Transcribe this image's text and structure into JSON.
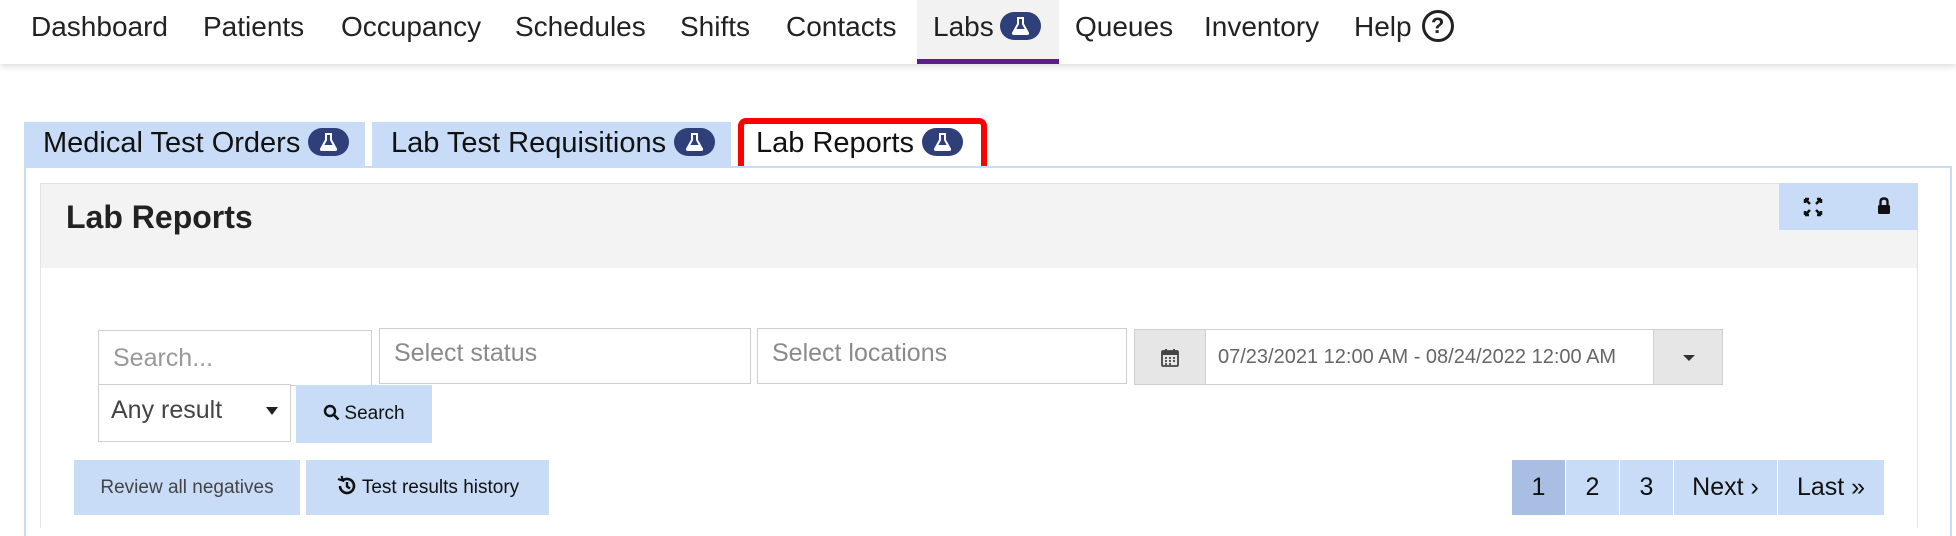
{
  "nav": {
    "items": [
      {
        "label": "Dashboard"
      },
      {
        "label": "Patients"
      },
      {
        "label": "Occupancy"
      },
      {
        "label": "Schedules"
      },
      {
        "label": "Shifts"
      },
      {
        "label": "Contacts"
      },
      {
        "label": "Labs"
      },
      {
        "label": "Queues"
      },
      {
        "label": "Inventory"
      },
      {
        "label": "Help"
      }
    ],
    "active": "Labs",
    "help_icon": "?"
  },
  "subtabs": [
    {
      "label": "Medical Test Orders"
    },
    {
      "label": "Lab Test Requisitions"
    },
    {
      "label": "Lab Reports"
    }
  ],
  "panel": {
    "title": "Lab Reports"
  },
  "filters": {
    "search_placeholder": "Search...",
    "status_placeholder": "Select status",
    "locations_placeholder": "Select locations",
    "date_range": "07/23/2021 12:00 AM - 08/24/2022 12:00 AM",
    "result_select": "Any result",
    "search_button": "Search"
  },
  "actions": {
    "review_negatives": "Review all negatives",
    "test_history": "Test results history"
  },
  "pagination": {
    "pages": [
      "1",
      "2",
      "3"
    ],
    "current": "1",
    "next": "Next ›",
    "last": "Last »"
  },
  "colors": {
    "accent_tab": "#c9dcf7",
    "active_nav_underline": "#5b1f8c",
    "badge": "#2f3f7a",
    "highlight": "#ff0000"
  }
}
